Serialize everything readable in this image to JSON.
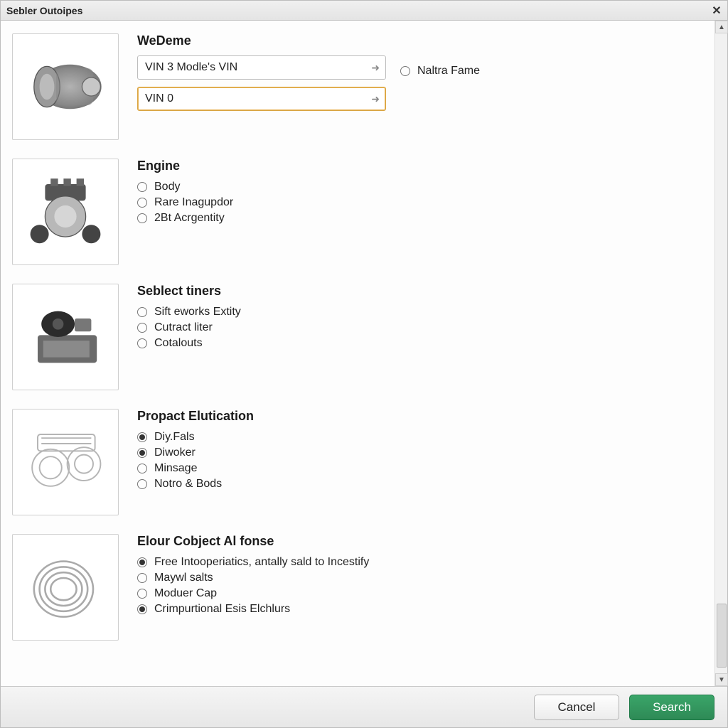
{
  "window": {
    "title": "Sebler Outoipes"
  },
  "sections": {
    "wedeme": {
      "title": "WeDeme",
      "combo1": "VIN 3 Modle's VIN",
      "combo2": "VIN 0",
      "side_radio": "Naltra Fame"
    },
    "engine": {
      "title": "Engine",
      "opts": [
        "Body",
        "Rare Inagupdor",
        "2Bt Acrgentity"
      ]
    },
    "seblect": {
      "title": "Seblect tiners",
      "opts": [
        "Sift eworks Extity",
        "Cutract liter",
        "Cotalouts"
      ]
    },
    "propact": {
      "title": "Propact Elutication",
      "opts": [
        "Diy.Fals",
        "Diwoker",
        "Minsage",
        "Notro & Bods"
      ],
      "checked": [
        true,
        true,
        false,
        false
      ]
    },
    "elour": {
      "title": "Elour Cobject Al fonse",
      "opts": [
        "Free Intooperiatics, antally sald to Incestify",
        "Maywl salts",
        "Moduer Cap",
        "Crimpurtional Esis Elchlurs"
      ],
      "checked": [
        true,
        false,
        false,
        true
      ]
    }
  },
  "footer": {
    "cancel": "Cancel",
    "search": "Search"
  }
}
